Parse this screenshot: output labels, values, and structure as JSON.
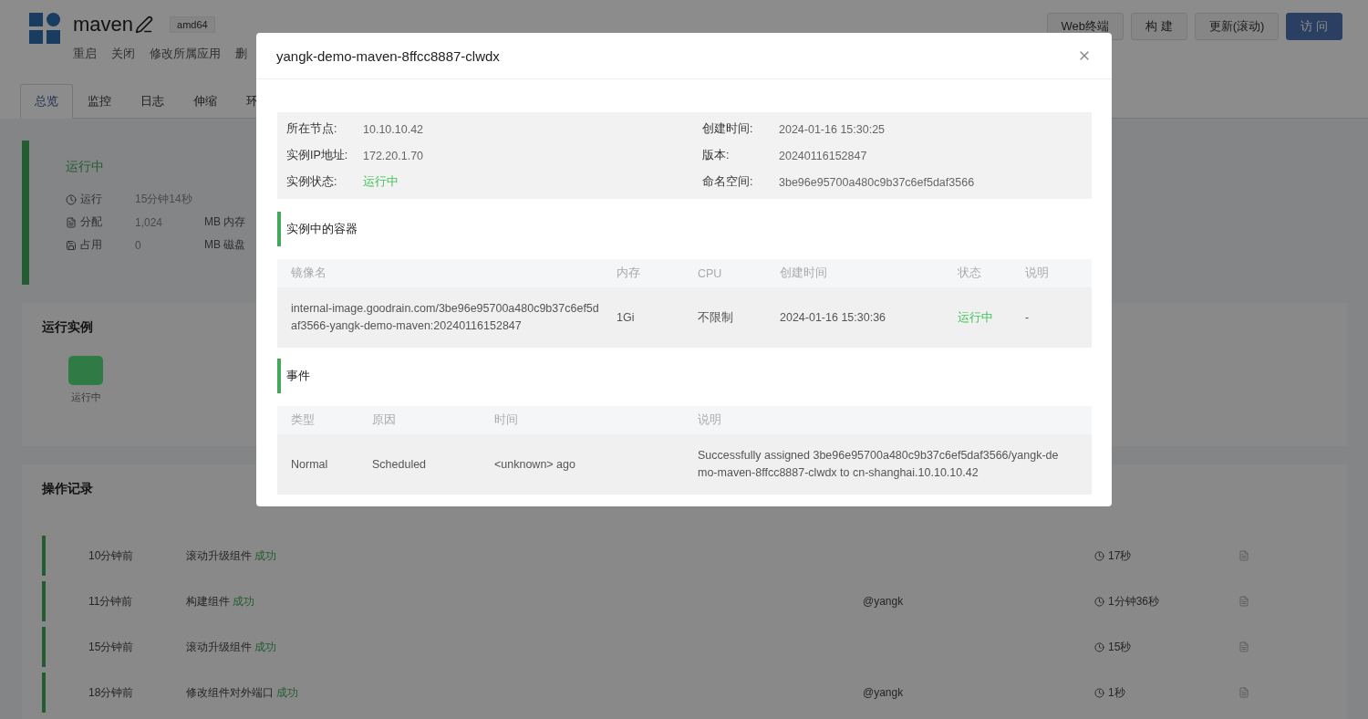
{
  "app": {
    "name": "maven",
    "arch": "amd64",
    "actions": [
      "重启",
      "关闭",
      "修改所属应用",
      "删"
    ]
  },
  "top_buttons": [
    {
      "label": "Web终端",
      "kind": "default"
    },
    {
      "label": "构 建",
      "kind": "default"
    },
    {
      "label": "更新(滚动)",
      "kind": "default"
    },
    {
      "label": "访 问",
      "kind": "primary"
    }
  ],
  "tabs": [
    {
      "label": "总览",
      "selected": true
    },
    {
      "label": "监控",
      "selected": false
    },
    {
      "label": "日志",
      "selected": false
    },
    {
      "label": "伸缩",
      "selected": false
    },
    {
      "label": "环",
      "selected": false
    }
  ],
  "status_card": {
    "status": "运行中",
    "stats": [
      {
        "kind": "clock",
        "label": "运行",
        "value": "15分钟14秒"
      },
      {
        "kind": "memory",
        "label": "分配",
        "value": "1,024",
        "unit": "MB 内存"
      },
      {
        "kind": "disk",
        "label": "占用",
        "value": "0",
        "unit": "MB 磁盘"
      }
    ]
  },
  "instances": {
    "title": "运行实例",
    "items": [
      {
        "label": "运行中",
        "color": "#2f7a45"
      }
    ]
  },
  "records": {
    "title": "操作记录",
    "rows": [
      {
        "time": "10分钟前",
        "action": "滚动升级组件",
        "result": "成功",
        "duration": "17秒"
      },
      {
        "time": "11分钟前",
        "action": "构建组件",
        "result": "成功",
        "user": "@yangk",
        "duration": "1分钟36秒"
      },
      {
        "time": "15分钟前",
        "action": "滚动升级组件",
        "result": "成功",
        "duration": "15秒"
      },
      {
        "time": "18分钟前",
        "action": "修改组件对外端口",
        "result": "成功",
        "user": "@yangk",
        "duration": "1秒"
      }
    ]
  },
  "modal": {
    "title": "yangk-demo-maven-8ffcc8887-clwdx",
    "info": [
      {
        "label": "所在节点:",
        "value": "10.10.10.42"
      },
      {
        "label": "创建时间:",
        "value": "2024-01-16 15:30:25"
      },
      {
        "label": "实例IP地址:",
        "value": "172.20.1.70"
      },
      {
        "label": "版本:",
        "value": "20240116152847"
      },
      {
        "label": "实例状态:",
        "value": "运行中",
        "kind": "status"
      },
      {
        "label": "命名空间:",
        "value": "3be96e95700a480c9b37c6ef5daf3566"
      }
    ],
    "containers": {
      "title": "实例中的容器",
      "columns": [
        "镜像名",
        "内存",
        "CPU",
        "创建时间",
        "状态",
        "说明"
      ],
      "rows": [
        {
          "image": "internal-image.goodrain.com/3be96e95700a480c9b37c6ef5daf3566-yangk-demo-maven:20240116152847",
          "memory": "1Gi",
          "cpu": "不限制",
          "created": "2024-01-16 15:30:36",
          "status": "运行中",
          "note": "-"
        }
      ]
    },
    "events": {
      "title": "事件",
      "columns": [
        "类型",
        "原因",
        "时间",
        "说明"
      ],
      "rows": [
        {
          "type": "Normal",
          "reason": "Scheduled",
          "time": "<unknown> ago",
          "message": "Successfully assigned 3be96e95700a480c9b37c6ef5daf3566/yangk-demo-maven-8ffcc8887-clwdx to cn-shanghai.10.10.10.42"
        }
      ]
    }
  }
}
